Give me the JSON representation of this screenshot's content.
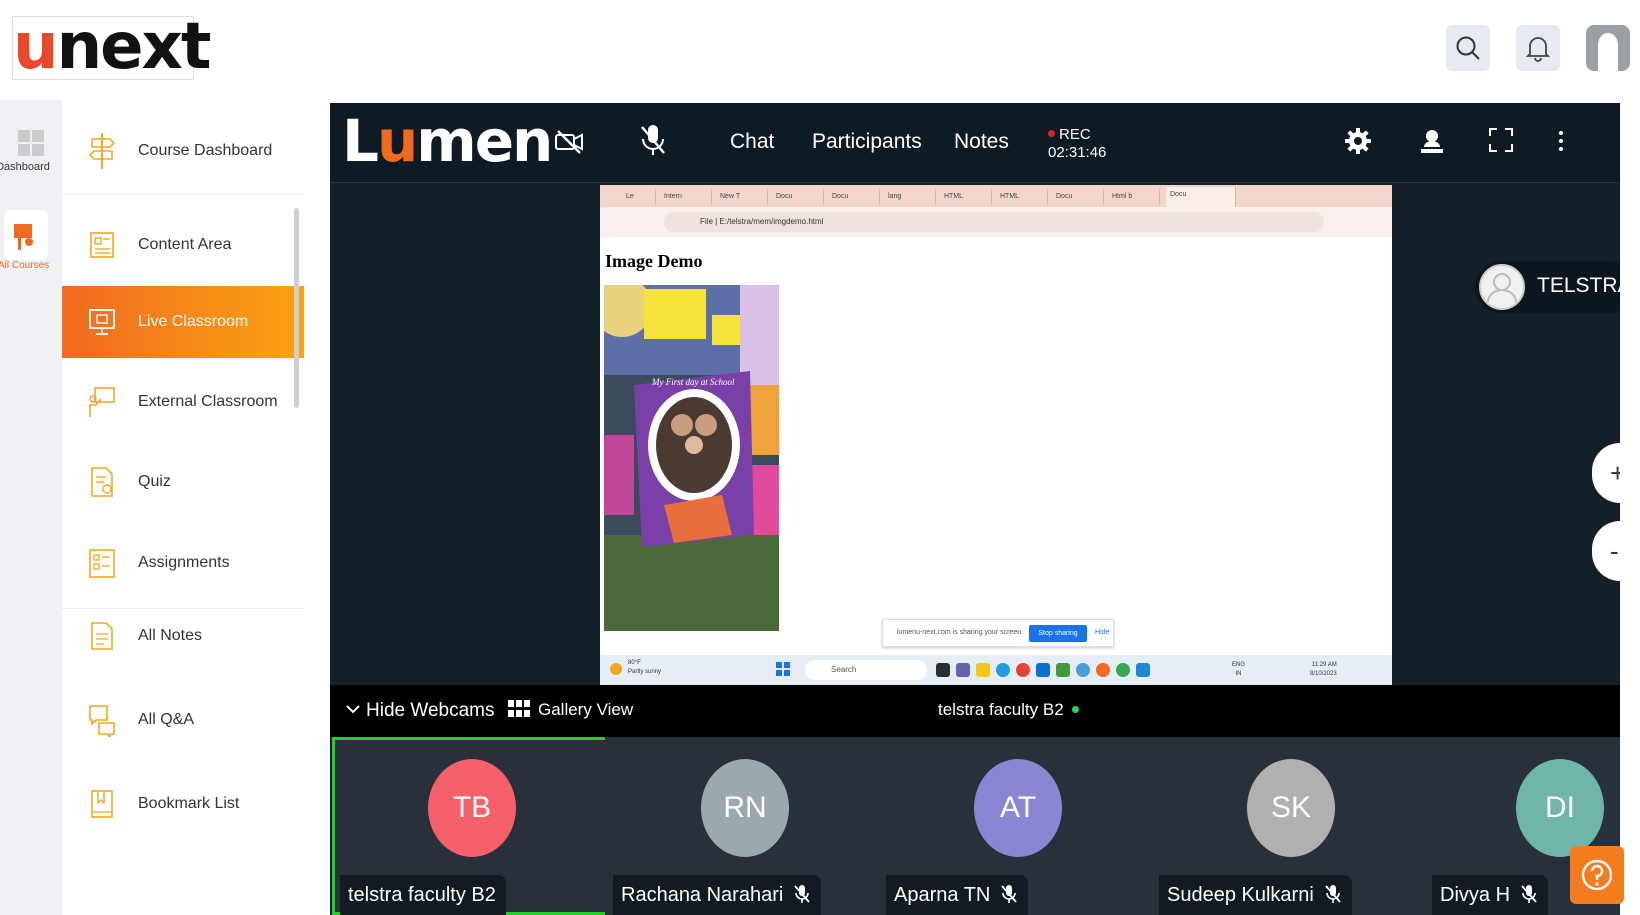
{
  "app": {
    "logo": {
      "u": "u",
      "rest": "next"
    }
  },
  "rail": [
    {
      "label": "Dashboard"
    },
    {
      "label": "All Courses"
    }
  ],
  "menu": [
    {
      "label": "Course Dashboard",
      "icon": "signpost-icon"
    },
    {
      "label": "Content Area",
      "icon": "content-icon"
    },
    {
      "label": "Live Classroom",
      "icon": "presentation-icon",
      "active": true
    },
    {
      "label": "External Classroom",
      "icon": "teacher-board-icon"
    },
    {
      "label": "Quiz",
      "icon": "quiz-icon"
    },
    {
      "label": "Assignments",
      "icon": "assignment-icon"
    },
    {
      "label": "All Notes",
      "icon": "notes-icon"
    },
    {
      "label": "All Q&A",
      "icon": "qa-icon"
    },
    {
      "label": "Bookmark List",
      "icon": "bookmark-icon"
    }
  ],
  "meeting": {
    "logo": {
      "l": "L",
      "o": "u",
      "rest": "men"
    },
    "chat": "Chat",
    "participants": "Participants",
    "notes": "Notes",
    "rec_label": "REC",
    "rec_time": "02:31:46",
    "presenter_label": "TELSTRA",
    "zoom_in": "+",
    "zoom_out": "-"
  },
  "shared_screen": {
    "tabs": [
      "Le",
      "Intern",
      "New T",
      "Docu",
      "Docu",
      "lang",
      "HTML",
      "HTML",
      "Docu",
      "Html b",
      "Docu"
    ],
    "url_prefix": "File",
    "url": "E:/telstra/mem/imgdemo.html",
    "page_heading": "Image Demo",
    "photo_caption": "My First day at School",
    "share_notice": "lumenu-next.com is sharing your screen.",
    "stop_sharing": "Stop sharing",
    "hide": "Hide",
    "weather_temp": "80°F",
    "weather_desc": "Partly sunny",
    "taskbar_search": "Search",
    "lang": "ENG",
    "lang_region": "IN",
    "clock_time": "11:29 AM",
    "clock_date": "8/10/2023"
  },
  "webcams": {
    "hide_label": "Hide Webcams",
    "gallery_label": "Gallery View",
    "active_speaker": "telstra faculty B2",
    "tiles": [
      {
        "initials": "TB",
        "name": "telstra faculty B2",
        "color": "#f5606a",
        "muted": false,
        "active": true
      },
      {
        "initials": "RN",
        "name": "Rachana Narahari",
        "color": "#9ba8ad",
        "muted": true,
        "active": false
      },
      {
        "initials": "AT",
        "name": "Aparna TN",
        "color": "#8a86d4",
        "muted": true,
        "active": false
      },
      {
        "initials": "SK",
        "name": "Sudeep Kulkarni",
        "color": "#b0b0b0",
        "muted": true,
        "active": false
      },
      {
        "initials": "DI",
        "name": "Divya H",
        "color": "#6fb5a8",
        "muted": true,
        "active": false
      }
    ]
  },
  "colors": {
    "accent": "#f26a21",
    "accent_end": "#fba311",
    "meeting_bg": "#13202a",
    "active_tile_border": "#23d023"
  }
}
